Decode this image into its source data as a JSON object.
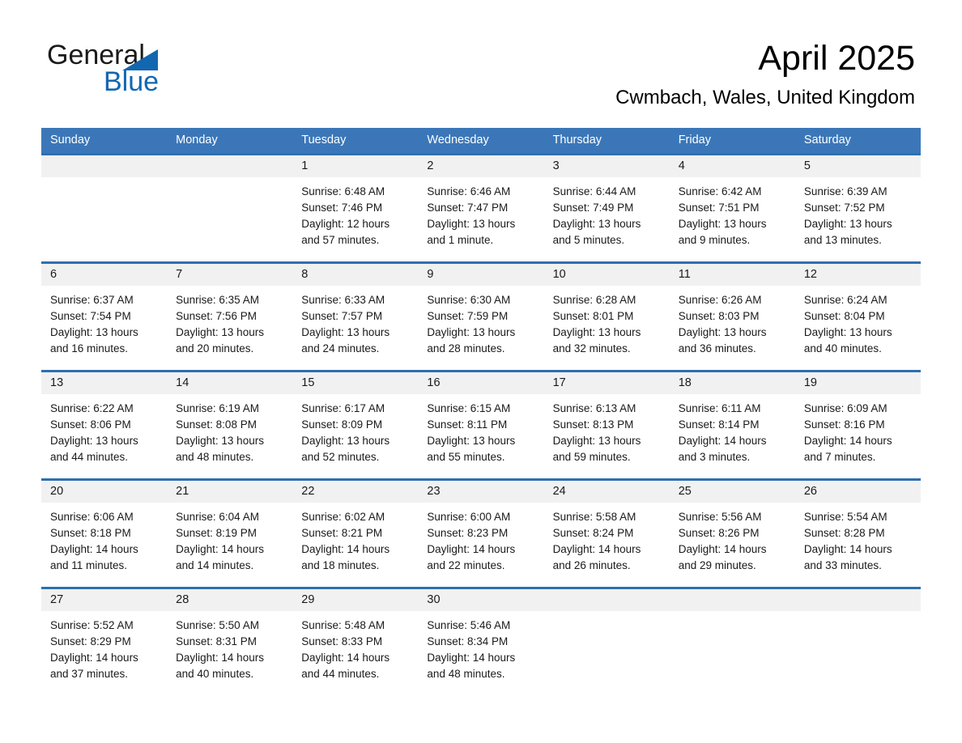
{
  "brand": {
    "line1": "General",
    "line2": "Blue",
    "triangle_color": "#1267b0"
  },
  "header": {
    "month_title": "April 2025",
    "location": "Cwmbach, Wales, United Kingdom"
  },
  "theme": {
    "header_blue": "#3b77b8",
    "row_divider_blue": "#2f6fb0",
    "day_band_gray": "#f1f1f1",
    "text_color": "#1a1a1a",
    "page_background": "#ffffff"
  },
  "weekdays": [
    "Sunday",
    "Monday",
    "Tuesday",
    "Wednesday",
    "Thursday",
    "Friday",
    "Saturday"
  ],
  "weeks": [
    [
      {
        "day": "",
        "sunrise": "",
        "sunset": "",
        "daylight_line1": "",
        "daylight_line2": ""
      },
      {
        "day": "",
        "sunrise": "",
        "sunset": "",
        "daylight_line1": "",
        "daylight_line2": ""
      },
      {
        "day": "1",
        "sunrise": "Sunrise: 6:48 AM",
        "sunset": "Sunset: 7:46 PM",
        "daylight_line1": "Daylight: 12 hours",
        "daylight_line2": "and 57 minutes."
      },
      {
        "day": "2",
        "sunrise": "Sunrise: 6:46 AM",
        "sunset": "Sunset: 7:47 PM",
        "daylight_line1": "Daylight: 13 hours",
        "daylight_line2": "and 1 minute."
      },
      {
        "day": "3",
        "sunrise": "Sunrise: 6:44 AM",
        "sunset": "Sunset: 7:49 PM",
        "daylight_line1": "Daylight: 13 hours",
        "daylight_line2": "and 5 minutes."
      },
      {
        "day": "4",
        "sunrise": "Sunrise: 6:42 AM",
        "sunset": "Sunset: 7:51 PM",
        "daylight_line1": "Daylight: 13 hours",
        "daylight_line2": "and 9 minutes."
      },
      {
        "day": "5",
        "sunrise": "Sunrise: 6:39 AM",
        "sunset": "Sunset: 7:52 PM",
        "daylight_line1": "Daylight: 13 hours",
        "daylight_line2": "and 13 minutes."
      }
    ],
    [
      {
        "day": "6",
        "sunrise": "Sunrise: 6:37 AM",
        "sunset": "Sunset: 7:54 PM",
        "daylight_line1": "Daylight: 13 hours",
        "daylight_line2": "and 16 minutes."
      },
      {
        "day": "7",
        "sunrise": "Sunrise: 6:35 AM",
        "sunset": "Sunset: 7:56 PM",
        "daylight_line1": "Daylight: 13 hours",
        "daylight_line2": "and 20 minutes."
      },
      {
        "day": "8",
        "sunrise": "Sunrise: 6:33 AM",
        "sunset": "Sunset: 7:57 PM",
        "daylight_line1": "Daylight: 13 hours",
        "daylight_line2": "and 24 minutes."
      },
      {
        "day": "9",
        "sunrise": "Sunrise: 6:30 AM",
        "sunset": "Sunset: 7:59 PM",
        "daylight_line1": "Daylight: 13 hours",
        "daylight_line2": "and 28 minutes."
      },
      {
        "day": "10",
        "sunrise": "Sunrise: 6:28 AM",
        "sunset": "Sunset: 8:01 PM",
        "daylight_line1": "Daylight: 13 hours",
        "daylight_line2": "and 32 minutes."
      },
      {
        "day": "11",
        "sunrise": "Sunrise: 6:26 AM",
        "sunset": "Sunset: 8:03 PM",
        "daylight_line1": "Daylight: 13 hours",
        "daylight_line2": "and 36 minutes."
      },
      {
        "day": "12",
        "sunrise": "Sunrise: 6:24 AM",
        "sunset": "Sunset: 8:04 PM",
        "daylight_line1": "Daylight: 13 hours",
        "daylight_line2": "and 40 minutes."
      }
    ],
    [
      {
        "day": "13",
        "sunrise": "Sunrise: 6:22 AM",
        "sunset": "Sunset: 8:06 PM",
        "daylight_line1": "Daylight: 13 hours",
        "daylight_line2": "and 44 minutes."
      },
      {
        "day": "14",
        "sunrise": "Sunrise: 6:19 AM",
        "sunset": "Sunset: 8:08 PM",
        "daylight_line1": "Daylight: 13 hours",
        "daylight_line2": "and 48 minutes."
      },
      {
        "day": "15",
        "sunrise": "Sunrise: 6:17 AM",
        "sunset": "Sunset: 8:09 PM",
        "daylight_line1": "Daylight: 13 hours",
        "daylight_line2": "and 52 minutes."
      },
      {
        "day": "16",
        "sunrise": "Sunrise: 6:15 AM",
        "sunset": "Sunset: 8:11 PM",
        "daylight_line1": "Daylight: 13 hours",
        "daylight_line2": "and 55 minutes."
      },
      {
        "day": "17",
        "sunrise": "Sunrise: 6:13 AM",
        "sunset": "Sunset: 8:13 PM",
        "daylight_line1": "Daylight: 13 hours",
        "daylight_line2": "and 59 minutes."
      },
      {
        "day": "18",
        "sunrise": "Sunrise: 6:11 AM",
        "sunset": "Sunset: 8:14 PM",
        "daylight_line1": "Daylight: 14 hours",
        "daylight_line2": "and 3 minutes."
      },
      {
        "day": "19",
        "sunrise": "Sunrise: 6:09 AM",
        "sunset": "Sunset: 8:16 PM",
        "daylight_line1": "Daylight: 14 hours",
        "daylight_line2": "and 7 minutes."
      }
    ],
    [
      {
        "day": "20",
        "sunrise": "Sunrise: 6:06 AM",
        "sunset": "Sunset: 8:18 PM",
        "daylight_line1": "Daylight: 14 hours",
        "daylight_line2": "and 11 minutes."
      },
      {
        "day": "21",
        "sunrise": "Sunrise: 6:04 AM",
        "sunset": "Sunset: 8:19 PM",
        "daylight_line1": "Daylight: 14 hours",
        "daylight_line2": "and 14 minutes."
      },
      {
        "day": "22",
        "sunrise": "Sunrise: 6:02 AM",
        "sunset": "Sunset: 8:21 PM",
        "daylight_line1": "Daylight: 14 hours",
        "daylight_line2": "and 18 minutes."
      },
      {
        "day": "23",
        "sunrise": "Sunrise: 6:00 AM",
        "sunset": "Sunset: 8:23 PM",
        "daylight_line1": "Daylight: 14 hours",
        "daylight_line2": "and 22 minutes."
      },
      {
        "day": "24",
        "sunrise": "Sunrise: 5:58 AM",
        "sunset": "Sunset: 8:24 PM",
        "daylight_line1": "Daylight: 14 hours",
        "daylight_line2": "and 26 minutes."
      },
      {
        "day": "25",
        "sunrise": "Sunrise: 5:56 AM",
        "sunset": "Sunset: 8:26 PM",
        "daylight_line1": "Daylight: 14 hours",
        "daylight_line2": "and 29 minutes."
      },
      {
        "day": "26",
        "sunrise": "Sunrise: 5:54 AM",
        "sunset": "Sunset: 8:28 PM",
        "daylight_line1": "Daylight: 14 hours",
        "daylight_line2": "and 33 minutes."
      }
    ],
    [
      {
        "day": "27",
        "sunrise": "Sunrise: 5:52 AM",
        "sunset": "Sunset: 8:29 PM",
        "daylight_line1": "Daylight: 14 hours",
        "daylight_line2": "and 37 minutes."
      },
      {
        "day": "28",
        "sunrise": "Sunrise: 5:50 AM",
        "sunset": "Sunset: 8:31 PM",
        "daylight_line1": "Daylight: 14 hours",
        "daylight_line2": "and 40 minutes."
      },
      {
        "day": "29",
        "sunrise": "Sunrise: 5:48 AM",
        "sunset": "Sunset: 8:33 PM",
        "daylight_line1": "Daylight: 14 hours",
        "daylight_line2": "and 44 minutes."
      },
      {
        "day": "30",
        "sunrise": "Sunrise: 5:46 AM",
        "sunset": "Sunset: 8:34 PM",
        "daylight_line1": "Daylight: 14 hours",
        "daylight_line2": "and 48 minutes."
      },
      {
        "day": "",
        "sunrise": "",
        "sunset": "",
        "daylight_line1": "",
        "daylight_line2": ""
      },
      {
        "day": "",
        "sunrise": "",
        "sunset": "",
        "daylight_line1": "",
        "daylight_line2": ""
      },
      {
        "day": "",
        "sunrise": "",
        "sunset": "",
        "daylight_line1": "",
        "daylight_line2": ""
      }
    ]
  ]
}
